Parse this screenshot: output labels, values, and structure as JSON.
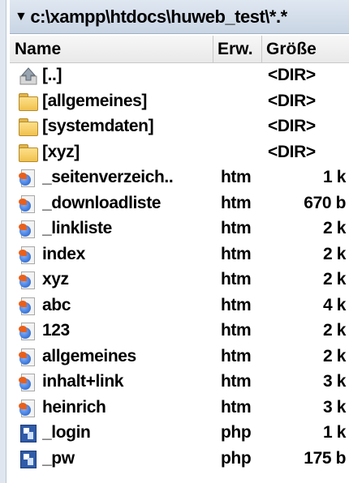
{
  "path": "c:\\xampp\\htdocs\\huweb_test\\*.*",
  "columns": {
    "name": "Name",
    "ext": "Erw.",
    "size": "Größe"
  },
  "rows": [
    {
      "icon": "up-dir-icon",
      "name": "[..]",
      "ext": "",
      "size": "<DIR>"
    },
    {
      "icon": "folder-icon",
      "name": "[allgemeines]",
      "ext": "",
      "size": "<DIR>"
    },
    {
      "icon": "folder-icon",
      "name": "[systemdaten]",
      "ext": "",
      "size": "<DIR>"
    },
    {
      "icon": "folder-icon",
      "name": "[xyz]",
      "ext": "",
      "size": "<DIR>"
    },
    {
      "icon": "htm-file-icon",
      "name": "_seitenverzeich..",
      "ext": "htm",
      "size": "1 k"
    },
    {
      "icon": "htm-file-icon",
      "name": "_downloadliste",
      "ext": "htm",
      "size": "670 b"
    },
    {
      "icon": "htm-file-icon",
      "name": "_linkliste",
      "ext": "htm",
      "size": "2 k"
    },
    {
      "icon": "htm-file-icon",
      "name": "index",
      "ext": "htm",
      "size": "2 k"
    },
    {
      "icon": "htm-file-icon",
      "name": "xyz",
      "ext": "htm",
      "size": "2 k"
    },
    {
      "icon": "htm-file-icon",
      "name": "abc",
      "ext": "htm",
      "size": "4 k"
    },
    {
      "icon": "htm-file-icon",
      "name": "123",
      "ext": "htm",
      "size": "2 k"
    },
    {
      "icon": "htm-file-icon",
      "name": "allgemeines",
      "ext": "htm",
      "size": "2 k"
    },
    {
      "icon": "htm-file-icon",
      "name": "inhalt+link",
      "ext": "htm",
      "size": "3 k"
    },
    {
      "icon": "htm-file-icon",
      "name": "heinrich",
      "ext": "htm",
      "size": "3 k"
    },
    {
      "icon": "php-file-icon",
      "name": "_login",
      "ext": "php",
      "size": "1 k"
    },
    {
      "icon": "php-file-icon",
      "name": "_pw",
      "ext": "php",
      "size": "175 b"
    }
  ]
}
